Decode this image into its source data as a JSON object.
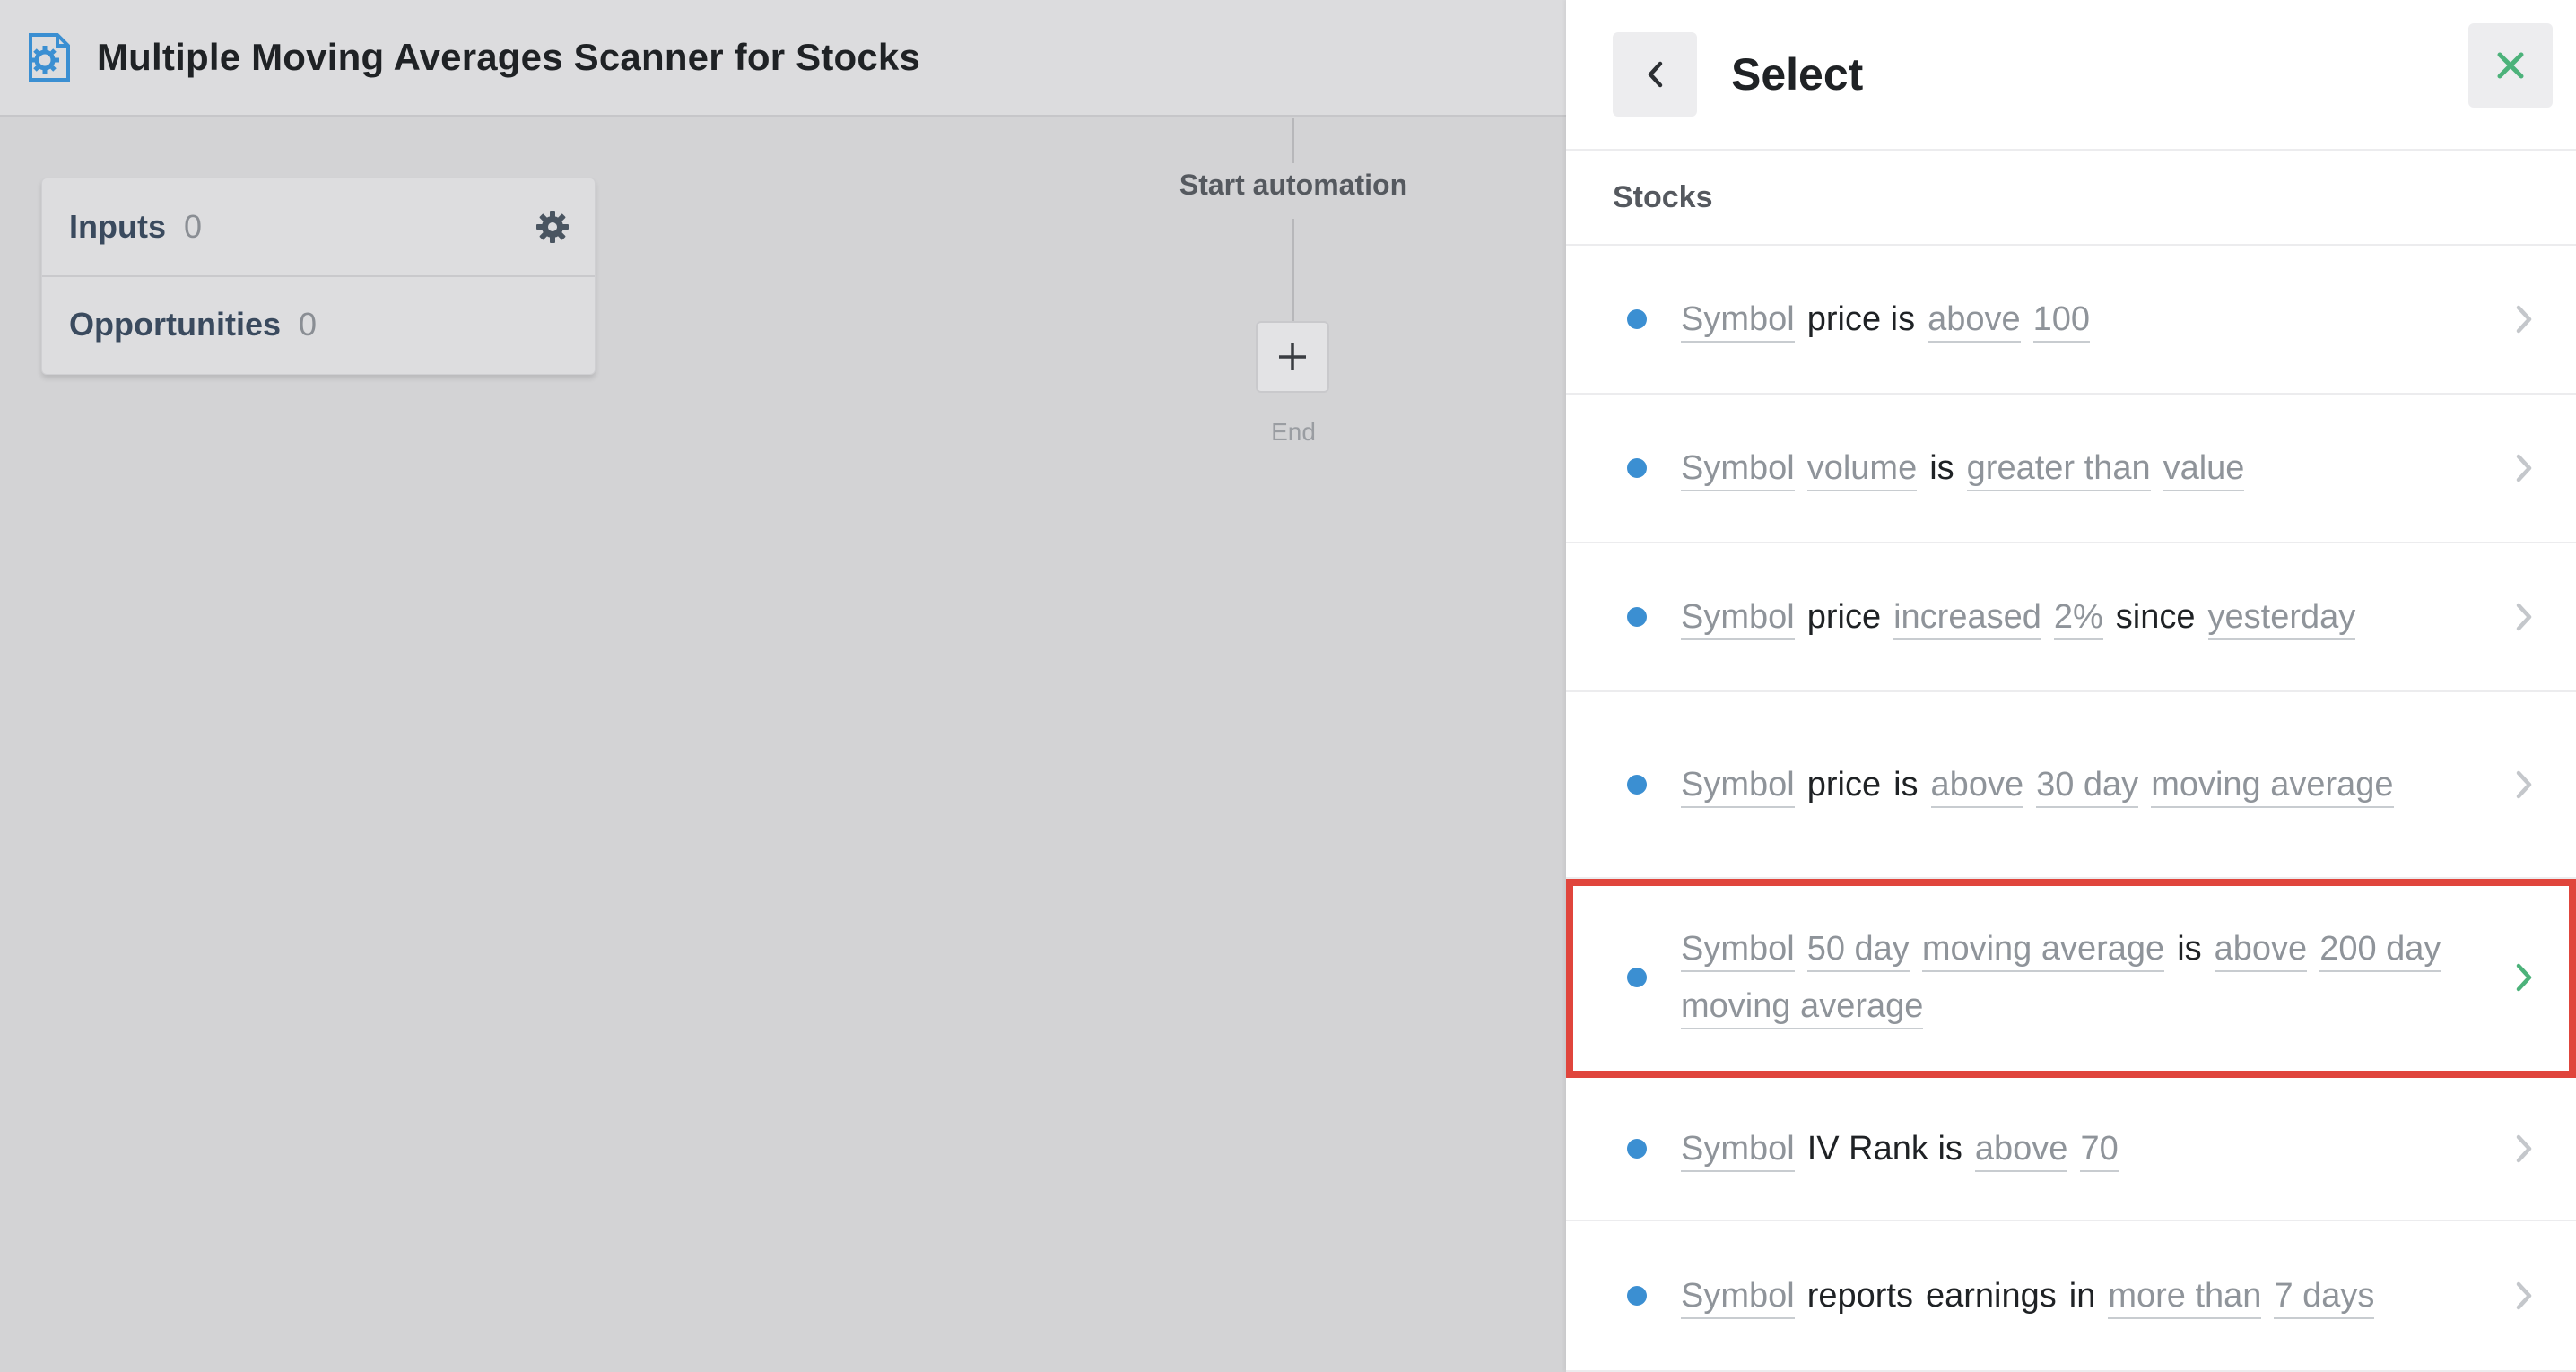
{
  "app": {
    "title": "Multiple Moving Averages Scanner for Stocks",
    "icon": "automation-gear-icon"
  },
  "io_card": {
    "rows": [
      {
        "label": "Inputs",
        "count": "0"
      },
      {
        "label": "Opportunities",
        "count": "0"
      }
    ]
  },
  "flow": {
    "start_label": "Start automation",
    "add_symbol": "+",
    "end_label": "End"
  },
  "panel": {
    "title": "Select",
    "section": "Stocks",
    "options": [
      {
        "words": [
          [
            "t",
            "Symbol"
          ],
          [
            "f",
            "price is"
          ],
          [
            "t",
            "above"
          ],
          [
            "t",
            "100"
          ]
        ]
      },
      {
        "words": [
          [
            "t",
            "Symbol"
          ],
          [
            "t",
            "volume"
          ],
          [
            "f",
            "is"
          ],
          [
            "t",
            "greater than"
          ],
          [
            "t",
            "value"
          ]
        ]
      },
      {
        "words": [
          [
            "t",
            "Symbol"
          ],
          [
            "f",
            "price"
          ],
          [
            "t",
            "increased"
          ],
          [
            "t",
            "2%"
          ],
          [
            "f",
            "since"
          ],
          [
            "t",
            "yesterday"
          ]
        ]
      },
      {
        "words": [
          [
            "t",
            "Symbol"
          ],
          [
            "f",
            "price"
          ],
          [
            "f",
            "is"
          ],
          [
            "t",
            "above"
          ],
          [
            "t",
            "30 day"
          ],
          [
            "t",
            "moving average"
          ]
        ]
      },
      {
        "words": [
          [
            "t",
            "Symbol"
          ],
          [
            "t",
            "50 day"
          ],
          [
            "t",
            "moving average"
          ],
          [
            "f",
            "is"
          ],
          [
            "t",
            "above"
          ],
          [
            "t",
            "200 day"
          ],
          [
            "t",
            "moving average"
          ]
        ],
        "highlighted": true
      },
      {
        "words": [
          [
            "t",
            "Symbol"
          ],
          [
            "f",
            "IV Rank is"
          ],
          [
            "t",
            "above"
          ],
          [
            "t",
            "70"
          ]
        ]
      },
      {
        "words": [
          [
            "t",
            "Symbol"
          ],
          [
            "f",
            "reports"
          ],
          [
            "f",
            "earnings"
          ],
          [
            "f",
            "in"
          ],
          [
            "t",
            "more than"
          ],
          [
            "t",
            "7 days"
          ]
        ]
      }
    ]
  },
  "colors": {
    "bullet": "#3b8fd2",
    "highlight_border": "#e0453c",
    "close_icon": "#4cb27a",
    "selected_chevron": "#4cb27a"
  }
}
